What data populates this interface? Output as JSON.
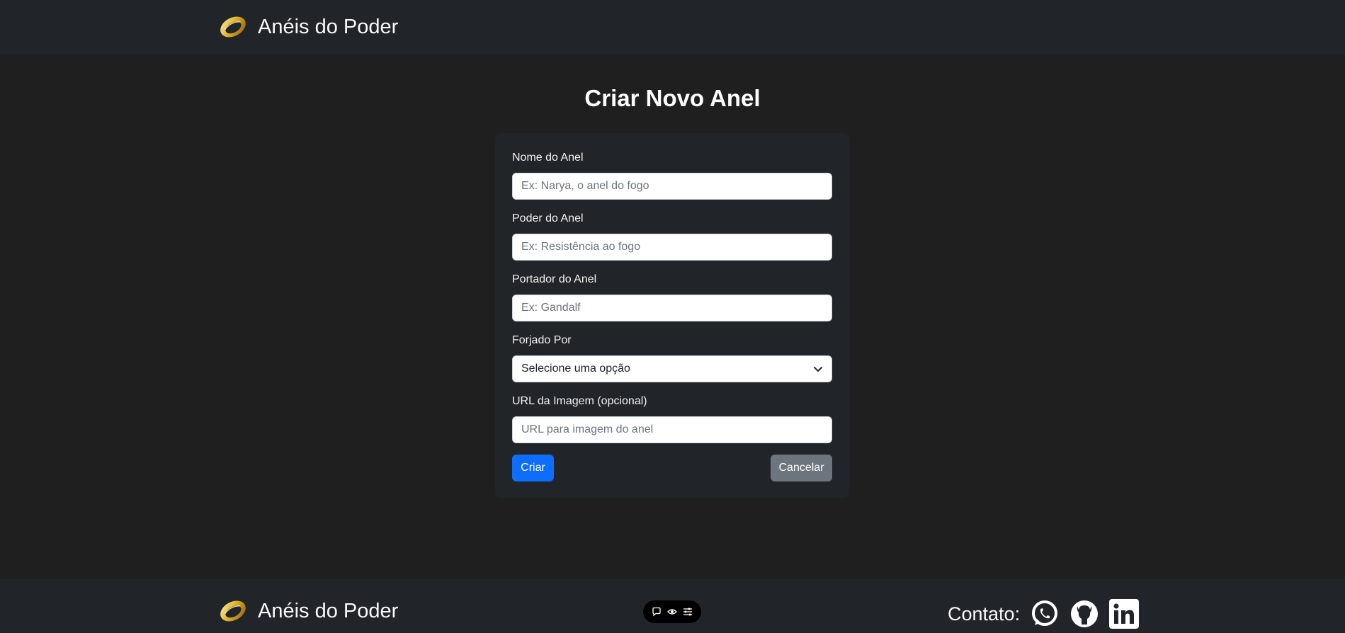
{
  "header": {
    "brand_name": "Anéis do Poder",
    "logo_icon": "ring-icon"
  },
  "page": {
    "title": "Criar Novo Anel"
  },
  "form": {
    "name": {
      "label": "Nome do Anel",
      "placeholder": "Ex: Narya, o anel do fogo",
      "value": ""
    },
    "power": {
      "label": "Poder do Anel",
      "placeholder": "Ex: Resistência ao fogo",
      "value": ""
    },
    "bearer": {
      "label": "Portador do Anel",
      "placeholder": "Ex: Gandalf",
      "value": ""
    },
    "forged_by": {
      "label": "Forjado Por",
      "selected": "Selecione uma opção"
    },
    "image_url": {
      "label": "URL da Imagem (opcional)",
      "placeholder": "URL para imagem do anel",
      "value": ""
    },
    "submit_label": "Criar",
    "cancel_label": "Cancelar"
  },
  "footer": {
    "brand_name": "Anéis do Poder",
    "contact_label": "Contato:",
    "social_icons": [
      "whatsapp-icon",
      "github-icon",
      "linkedin-icon"
    ]
  },
  "toolbar_icons": [
    "comment-icon",
    "eye-icon",
    "settings-sliders-icon"
  ],
  "colors": {
    "background": "#1f1f1f",
    "navbar": "#212529",
    "card": "#212529",
    "primary": "#0d6efd",
    "secondary": "#6c757d",
    "ring_gold": "#d4a017"
  }
}
